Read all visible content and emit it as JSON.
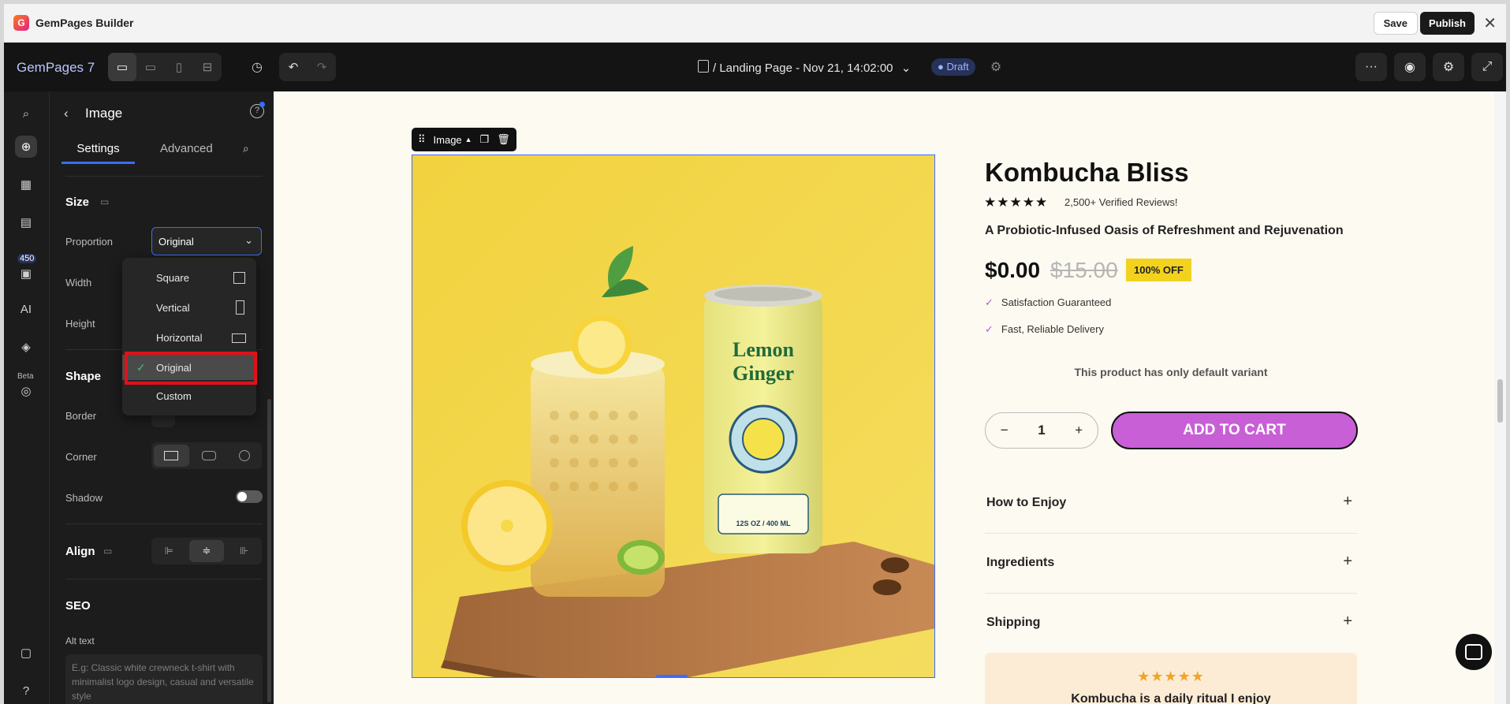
{
  "window": {
    "app_title": "GemPages Builder",
    "save_label": "Save",
    "publish_label": "Publish"
  },
  "toolbar": {
    "brand": "GemPages 7",
    "page_name": "/ Landing Page - Nov 21, 14:02:00",
    "status": "Draft"
  },
  "rail": {
    "badge_count": "450",
    "ai_label": "AI",
    "beta_label": "Beta"
  },
  "panel": {
    "title": "Image",
    "tabs": {
      "settings": "Settings",
      "advanced": "Advanced"
    },
    "size_section": "Size",
    "proportion_label": "Proportion",
    "proportion_value": "Original",
    "width_label": "Width",
    "height_label": "Height",
    "shape_section": "Shape",
    "border_label": "Border",
    "corner_label": "Corner",
    "shadow_label": "Shadow",
    "align_section": "Align",
    "seo_section": "SEO",
    "alt_text_label": "Alt text",
    "alt_text_placeholder": "E.g: Classic white crewneck t-shirt with minimalist logo design, casual and versatile style"
  },
  "dropdown": {
    "options": [
      "Square",
      "Vertical",
      "Horizontal",
      "Original",
      "Custom"
    ],
    "selected": "Original"
  },
  "canvas": {
    "image_tag": "Image",
    "product": {
      "title": "Kombucha Bliss",
      "stars": "★★★★★",
      "reviews": "2,500+ Verified Reviews!",
      "subtitle": "A Probiotic-Infused Oasis of Refreshment and Rejuvenation",
      "price": "$0.00",
      "compare_price": "$15.00",
      "discount": "100% OFF",
      "features": [
        "Satisfaction Guaranteed",
        "Fast, Reliable Delivery"
      ],
      "variant_note": "This product has only default variant",
      "quantity": "1",
      "add_to_cart": "ADD TO CART",
      "accordion": [
        "How to Enjoy",
        "Ingredients",
        "Shipping"
      ],
      "review_stars": "★★★★★",
      "review_quote": "Kombucha is a daily ritual I enjoy"
    },
    "can_label_1": "Lemon",
    "can_label_2": "Ginger",
    "can_volume": "12S OZ / 400 ML"
  },
  "colors": {
    "accent": "#3b6cff",
    "cart_button": "#c85fd6",
    "discount_badge": "#f3d21f",
    "highlight": "#e0111a"
  }
}
